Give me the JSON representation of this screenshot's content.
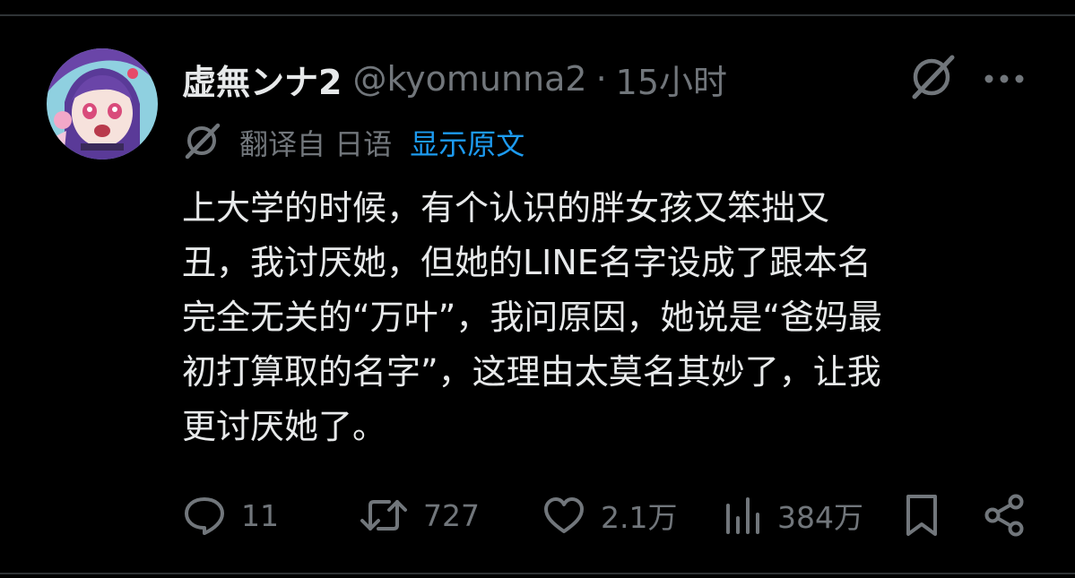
{
  "tweet": {
    "author": {
      "display_name": "虚無ンナ2",
      "handle": "@kyomunna2",
      "separator": "·",
      "time": "15小时"
    },
    "translation": {
      "label": "翻译自 日语",
      "show_original": "显示原文"
    },
    "text": "上大学的时候，有个认识的胖女孩又笨拙又\n丑，我讨厌她，但她的LINE名字设成了跟本名\n完全无关的“万叶”，我问原因，她说是“爸妈最\n初打算取的名字”，这理由太莫名其妙了，让我\n更讨厌她了。",
    "stats": {
      "replies": "11",
      "reposts": "727",
      "likes": "2.1万",
      "views": "384万"
    }
  },
  "icons": {
    "grok": "slash-circle-icon",
    "more": "more-dots-icon",
    "reply": "speech-bubble-icon",
    "repost": "repost-arrows-icon",
    "like": "heart-icon",
    "views": "bar-chart-icon",
    "bookmark": "bookmark-icon",
    "share": "share-icon"
  },
  "colors": {
    "background": "#000000",
    "text": "#e7e9ea",
    "muted": "#71767b",
    "link": "#1d9bf0",
    "divider": "#2f3336"
  }
}
